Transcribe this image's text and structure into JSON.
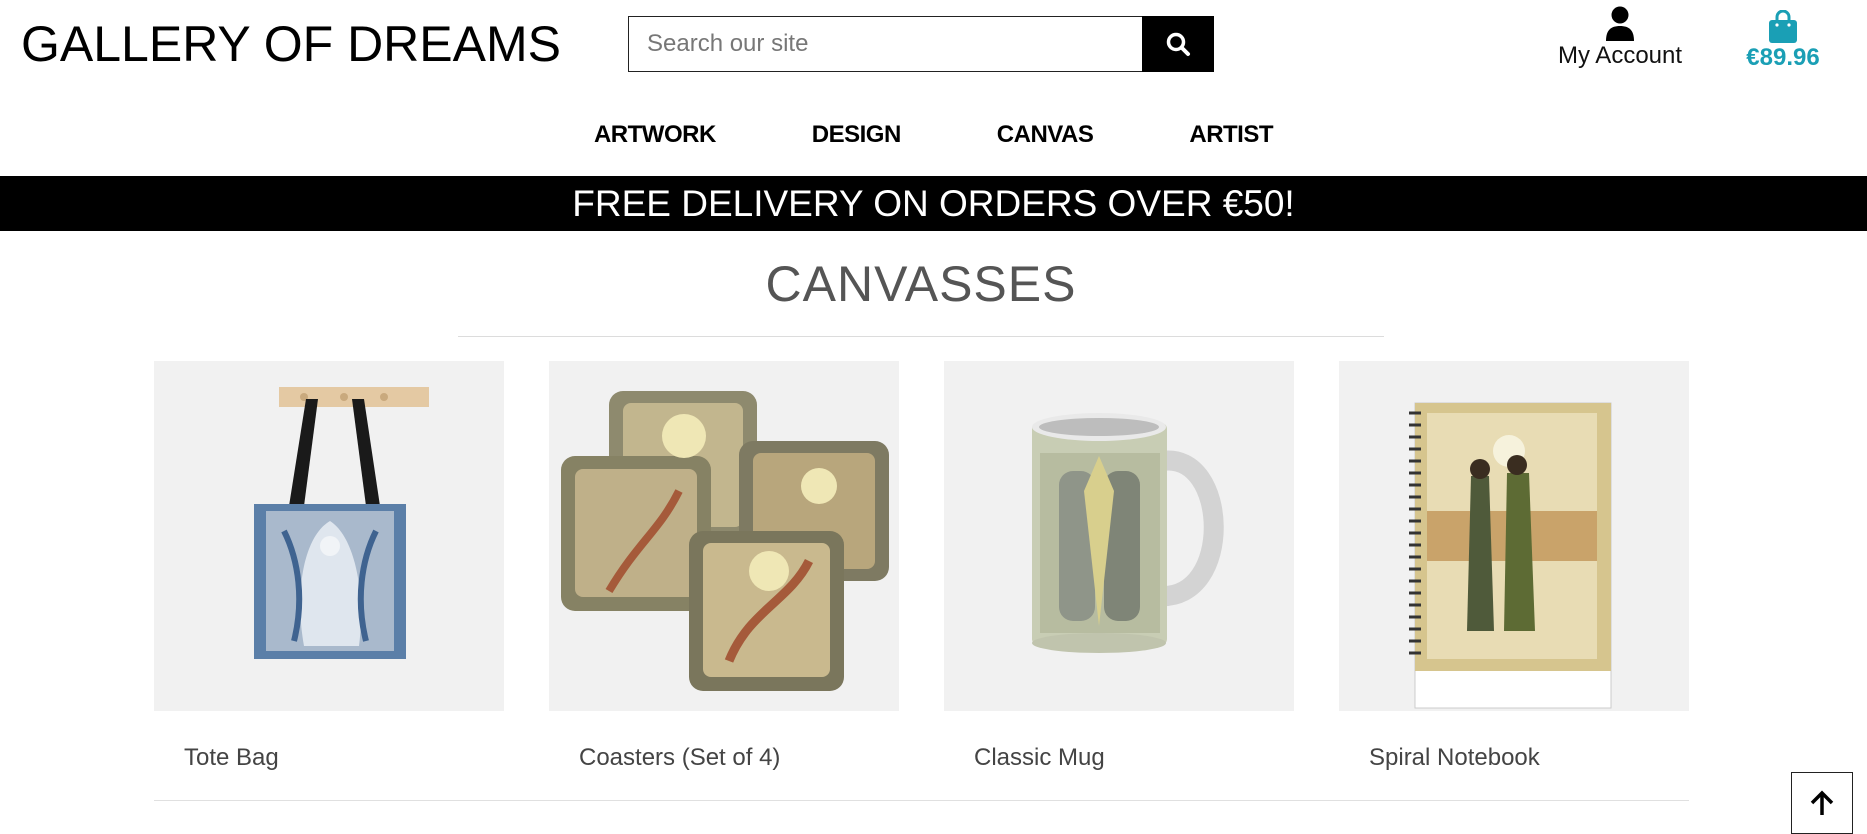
{
  "header": {
    "brand": "GALLERY OF DREAMS",
    "search_placeholder": "Search our site",
    "search_icon": "magnifier-icon",
    "account_label": "My Account",
    "account_icon": "user-icon",
    "bag_total": "€89.96",
    "bag_icon": "shopping-bag-icon",
    "accent_color": "#1a9fb5"
  },
  "nav": {
    "items": [
      "ARTWORK",
      "DESIGN",
      "CANVAS",
      "ARTIST"
    ]
  },
  "banner": {
    "text": "FREE DELIVERY ON ORDERS OVER €50!"
  },
  "main": {
    "title": "CANVASSES",
    "products": [
      {
        "name": "Tote Bag"
      },
      {
        "name": "Coasters (Set of 4)"
      },
      {
        "name": "Classic Mug"
      },
      {
        "name": "Spiral Notebook"
      }
    ]
  },
  "back_to_top_icon": "arrow-up-icon"
}
